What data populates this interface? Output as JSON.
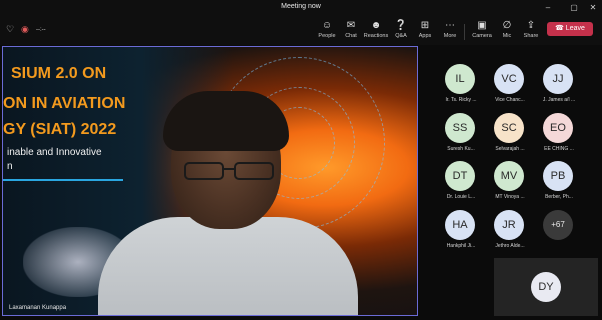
{
  "window": {
    "title": "Meeting now"
  },
  "titlebar": {
    "minimize": "–",
    "maximize": "▢",
    "close": "✕"
  },
  "toolbar": {
    "timer": "--:--",
    "buttons": [
      {
        "label": "People",
        "icon": "people-icon"
      },
      {
        "label": "Chat",
        "icon": "chat-icon"
      },
      {
        "label": "Reactions",
        "icon": "reactions-icon"
      },
      {
        "label": "Q&A",
        "icon": "qa-icon"
      },
      {
        "label": "Apps",
        "icon": "apps-icon"
      },
      {
        "label": "More",
        "icon": "more-icon"
      },
      {
        "label": "Camera",
        "icon": "camera-icon"
      },
      {
        "label": "Mic",
        "icon": "mic-icon"
      },
      {
        "label": "Share",
        "icon": "share-icon"
      }
    ],
    "leave_label": "Leave",
    "colors": {
      "leave": "#c4314b"
    }
  },
  "stage": {
    "slide_lines": [
      "SIUM 2.0 ON",
      "ON IN AVIATION",
      "GY (SIAT) 2022"
    ],
    "slide_sub": [
      "inable and Innovative",
      "n"
    ],
    "speaker_name": "Laxamanan Kunappa"
  },
  "gallery": {
    "participants": [
      {
        "initials": "IL",
        "name": "Ir. Ts. Ricky ...",
        "color": "#cfe8cf"
      },
      {
        "initials": "VC",
        "name": "Vice Chanc...",
        "color": "#d8e2f4"
      },
      {
        "initials": "JJ",
        "name": "J. James a/l ...",
        "color": "#d8e2f4"
      },
      {
        "initials": "SS",
        "name": "Suresh Ku...",
        "color": "#cfe8cf"
      },
      {
        "initials": "SC",
        "name": "Selvarajah ...",
        "color": "#f7e3c9"
      },
      {
        "initials": "EO",
        "name": "EE CHING ...",
        "color": "#f4d8d8"
      },
      {
        "initials": "DT",
        "name": "Dr. Louie L...",
        "color": "#cfe8cf"
      },
      {
        "initials": "MV",
        "name": "MT Vinoya ...",
        "color": "#cfe8cf"
      },
      {
        "initials": "PB",
        "name": "Berber, Ph...",
        "color": "#d8e2f4"
      },
      {
        "initials": "HA",
        "name": "Hankphil Ji...",
        "color": "#d8e2f4"
      },
      {
        "initials": "JR",
        "name": "Jethro Alde...",
        "color": "#d8e2f4"
      },
      {
        "initials": "+67",
        "name": "",
        "color": "#3a3a3a"
      }
    ],
    "self": {
      "initials": "DY"
    }
  }
}
